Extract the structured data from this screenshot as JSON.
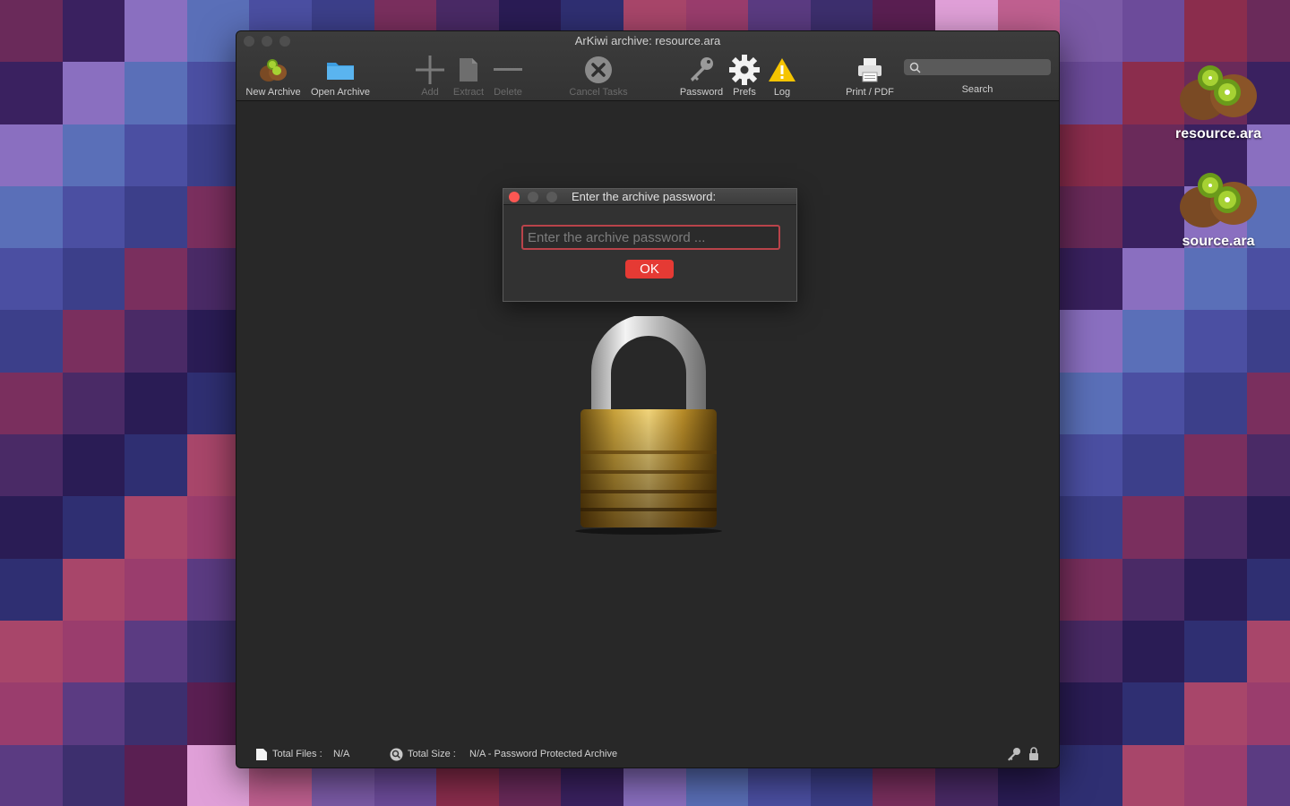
{
  "window": {
    "title": "ArKiwi archive: resource.ara"
  },
  "toolbar": {
    "new_archive": "New Archive",
    "open_archive": "Open Archive",
    "add": "Add",
    "extract": "Extract",
    "delete": "Delete",
    "cancel_tasks": "Cancel Tasks",
    "password": "Password",
    "prefs": "Prefs",
    "log": "Log",
    "print_pdf": "Print / PDF",
    "search_label": "Search"
  },
  "dialog": {
    "title": "Enter the archive password:",
    "placeholder": "Enter the archive password ...",
    "ok_label": "OK"
  },
  "status": {
    "total_files_label": "Total Files :",
    "total_files_value": "N/A",
    "total_size_label": "Total Size :",
    "total_size_value": "N/A - Password Protected Archive"
  },
  "desktop": {
    "icons": [
      {
        "label": "resource.ara",
        "icon": "kiwi-archive-icon"
      },
      {
        "label": "source.ara",
        "icon": "kiwi-archive-icon"
      }
    ]
  },
  "colors": {
    "accent_red": "#e53a34",
    "close_light": "#fc5753",
    "window_bg": "#282828",
    "warning_yellow": "#f5c400"
  }
}
